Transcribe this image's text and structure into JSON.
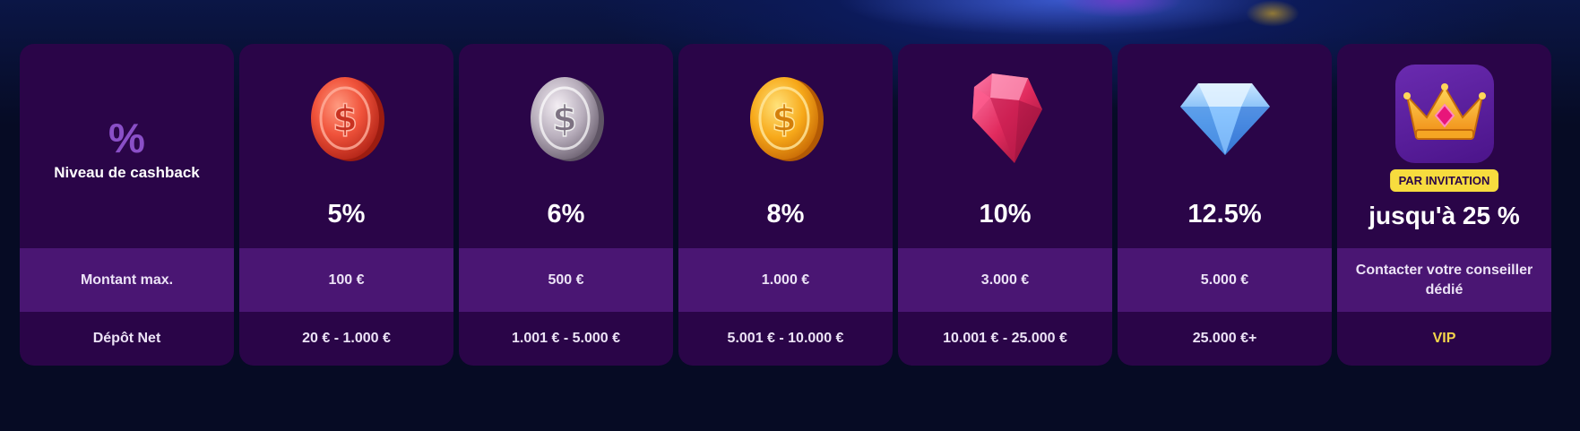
{
  "header_column": {
    "percent_symbol": "%",
    "level_label": "Niveau de cashback",
    "max_amount_label": "Montant max.",
    "net_deposit_label": "Dépôt Net"
  },
  "tiers": [
    {
      "icon": "red-coin-icon",
      "cashback": "5%",
      "max_amount": "100 €",
      "net_deposit": "20 € - 1.000 €"
    },
    {
      "icon": "silver-coin-icon",
      "cashback": "6%",
      "max_amount": "500 €",
      "net_deposit": "1.001 € - 5.000 €"
    },
    {
      "icon": "gold-coin-icon",
      "cashback": "8%",
      "max_amount": "1.000 €",
      "net_deposit": "5.001 € - 10.000 €"
    },
    {
      "icon": "ruby-gem-icon",
      "cashback": "10%",
      "max_amount": "3.000 €",
      "net_deposit": "10.001 € - 25.000 €"
    },
    {
      "icon": "diamond-icon",
      "cashback": "12.5%",
      "max_amount": "5.000 €",
      "net_deposit": "25.000 €+"
    }
  ],
  "vip": {
    "icon": "crown-icon",
    "badge": "PAR INVITATION",
    "cashback": "jusqu'à 25 %",
    "max_amount": "Contacter votre conseiller dédié",
    "net_deposit": "VIP"
  },
  "colors": {
    "background": "#060b24",
    "card": "#2a0548",
    "card_band": "#4a1673",
    "badge": "#f7dc3e",
    "vip_text": "#f5d64b"
  }
}
